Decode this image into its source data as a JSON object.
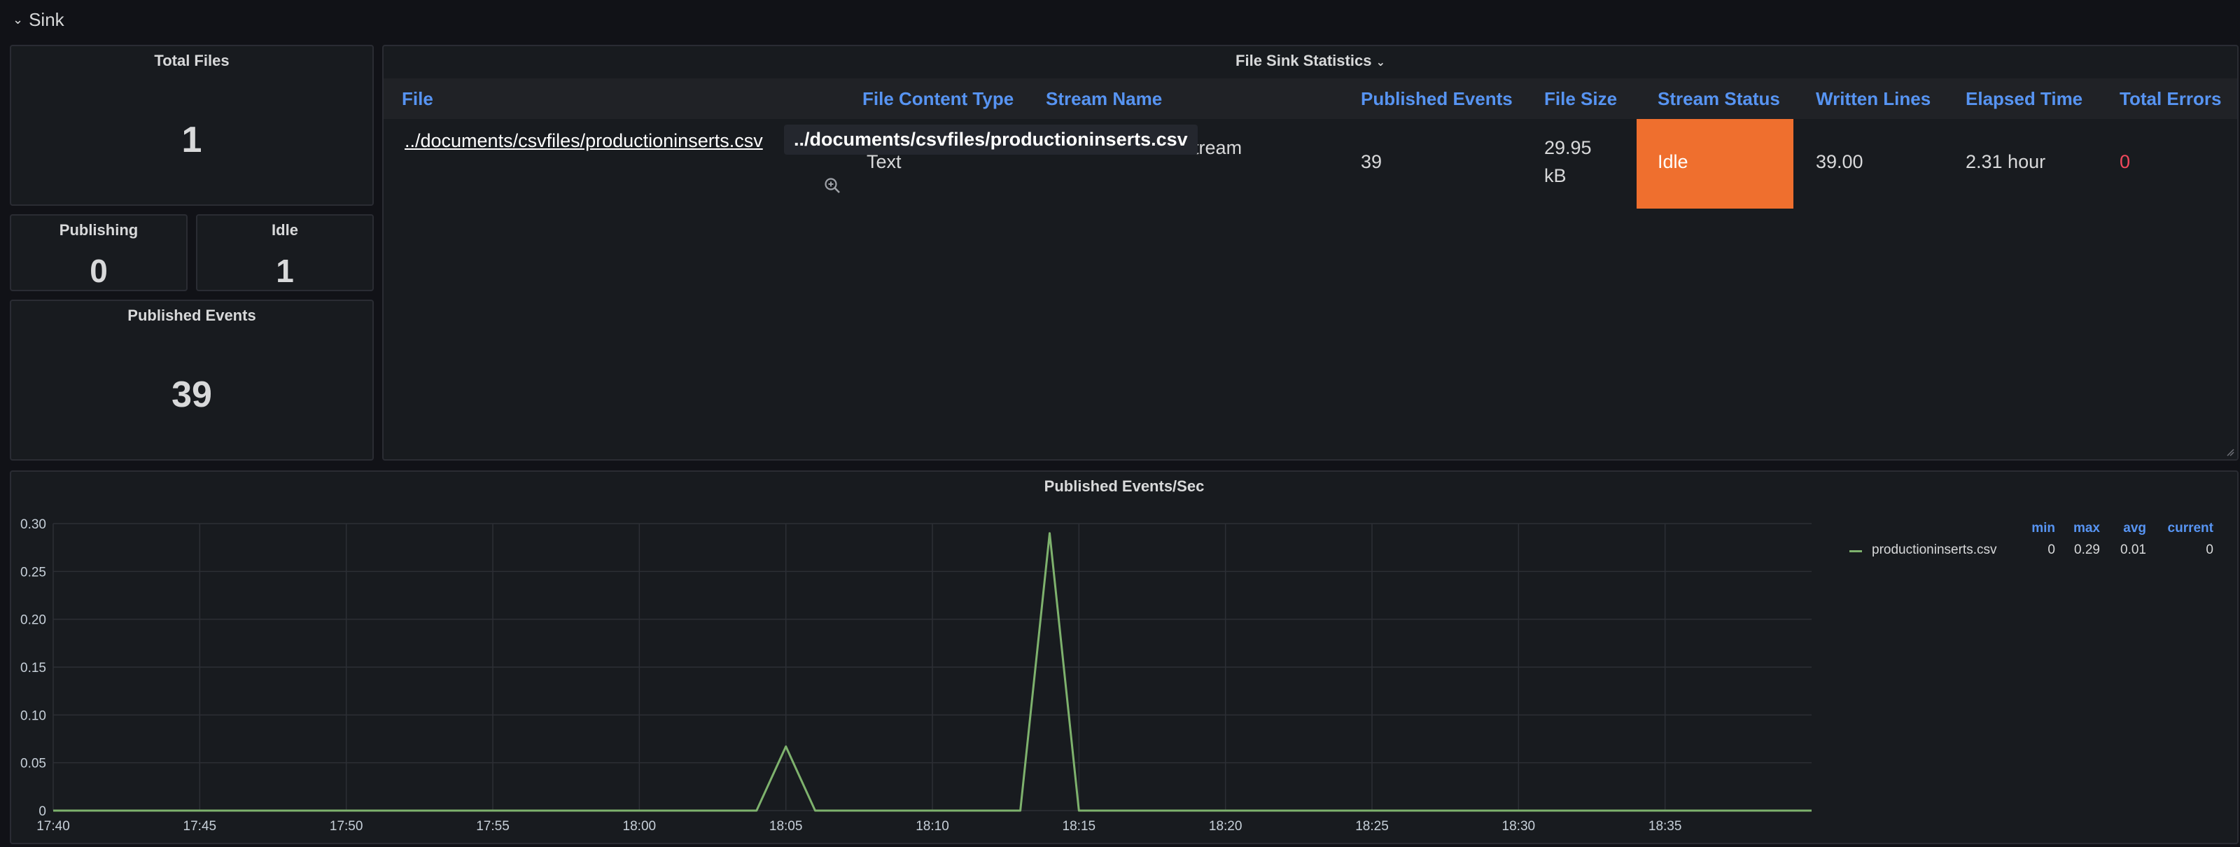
{
  "row": {
    "title": "Sink"
  },
  "stats": {
    "total_files": {
      "title": "Total Files",
      "value": "1"
    },
    "publishing": {
      "title": "Publishing",
      "value": "0"
    },
    "idle": {
      "title": "Idle",
      "value": "1"
    },
    "published_events": {
      "title": "Published Events",
      "value": "39"
    }
  },
  "table": {
    "title": "File Sink Statistics",
    "columns": [
      "File",
      "File Content Type",
      "Stream Name",
      "Published Events",
      "File Size",
      "Stream Status",
      "Written Lines",
      "Elapsed Time",
      "Total Errors"
    ],
    "row": {
      "file": "../documents/csvfiles/productioninserts.csv",
      "content_type": "Text",
      "stream_name": "atesStream",
      "published_events": "39",
      "file_size_1": "29.95",
      "file_size_2": "kB",
      "status": "Idle",
      "written_lines": "39.00",
      "elapsed": "2.31 hour",
      "errors": "0"
    },
    "tooltip": "../documents/csvfiles/productioninserts.csv",
    "colors": {
      "header": "#5794f2",
      "idle": "#ef6f2e",
      "error": "#f2495c"
    }
  },
  "graph": {
    "title": "Published Events/Sec",
    "legend": {
      "headers": [
        "min",
        "max",
        "avg",
        "current"
      ],
      "series_name": "productioninserts.csv",
      "values": [
        "0",
        "0.29",
        "0.01",
        "0"
      ]
    },
    "y_ticks": [
      "0.30",
      "0.25",
      "0.20",
      "0.15",
      "0.10",
      "0.05",
      "0"
    ],
    "x_ticks": [
      "17:40",
      "17:45",
      "17:50",
      "17:55",
      "18:00",
      "18:05",
      "18:10",
      "18:15",
      "18:20",
      "18:25",
      "18:30",
      "18:35"
    ]
  },
  "chart_data": {
    "type": "line",
    "title": "Published Events/Sec",
    "ylim": [
      0,
      0.3
    ],
    "xlim": [
      "17:40",
      "18:40"
    ],
    "grid": true,
    "legend_position": "right",
    "series": [
      {
        "name": "productioninserts.csv",
        "color": "#7eb26d",
        "x": [
          "17:40",
          "18:04",
          "18:05",
          "18:06",
          "18:13",
          "18:14",
          "18:15",
          "18:40"
        ],
        "values": [
          0,
          0,
          0.067,
          0,
          0,
          0.29,
          0,
          0
        ]
      }
    ]
  }
}
